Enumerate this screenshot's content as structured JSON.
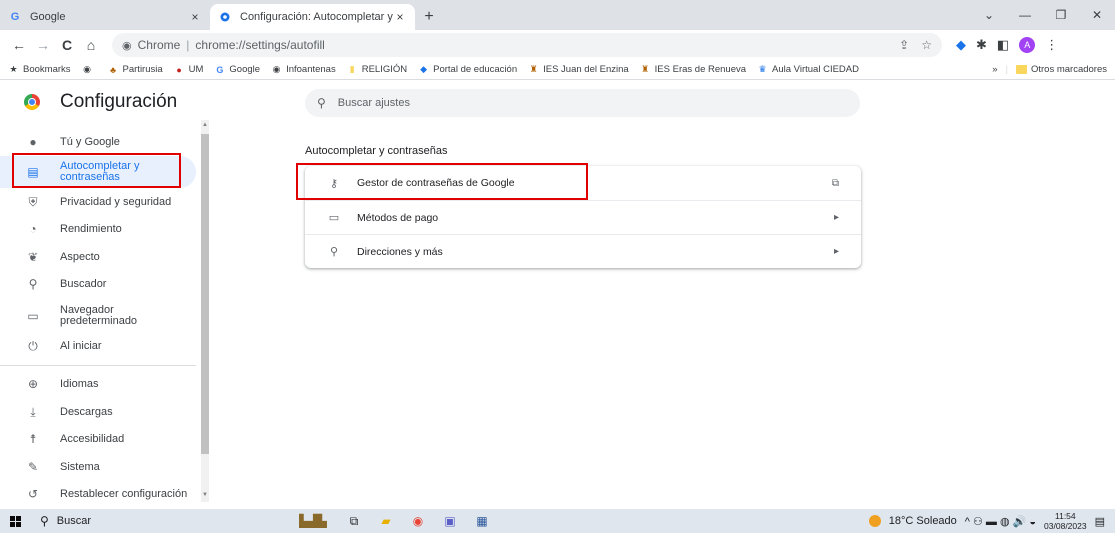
{
  "tabs": [
    {
      "title": "Google",
      "favicon": "G",
      "close": "×",
      "active": false
    },
    {
      "title": "Configuración: Autocompletar y ",
      "favicon": "gear-icon",
      "close": "×",
      "active": true
    }
  ],
  "new_tab": "+",
  "window_controls": {
    "chevron": "⌄",
    "minimize": "—",
    "restore": "❐",
    "close": "✕"
  },
  "toolbar": {
    "back": "←",
    "forward": "→",
    "reload": "C",
    "home": "⌂",
    "site_label": "Chrome",
    "separator": "|",
    "url": "chrome://settings/autofill",
    "share": "⇪",
    "star": "☆",
    "avatar_letter": "A",
    "menu": "⋮"
  },
  "bookmarks": {
    "items": [
      {
        "label": "Bookmarks",
        "icon": "★"
      },
      {
        "label": "",
        "icon": "◉"
      },
      {
        "label": "Partirusia",
        "icon": "♣"
      },
      {
        "label": "UM",
        "icon": "●"
      },
      {
        "label": "Google",
        "icon": "G"
      },
      {
        "label": "Infoantenas",
        "icon": "◉"
      },
      {
        "label": "RELIGIÓN",
        "icon": "▮"
      },
      {
        "label": "Portal de educación",
        "icon": "◆"
      },
      {
        "label": "IES Juan del Enzina",
        "icon": "♜"
      },
      {
        "label": "IES Eras de Renueva",
        "icon": "♜"
      },
      {
        "label": "Aula Virtual CIEDAD",
        "icon": "♛"
      }
    ],
    "more": "»",
    "other_folder": "Otros marcadores"
  },
  "settings": {
    "title": "Configuración",
    "search_placeholder": "Buscar ajustes"
  },
  "sidebar": {
    "items": [
      {
        "label": "Tú y Google",
        "icon": "👤"
      },
      {
        "label": "Autocompletar y contraseñas",
        "icon": "▤",
        "selected": true
      },
      {
        "label": "Privacidad y seguridad",
        "icon": "⛨"
      },
      {
        "label": "Rendimiento",
        "icon": "◔"
      },
      {
        "label": "Aspecto",
        "icon": "🎨"
      },
      {
        "label": "Buscador",
        "icon": "⌕"
      },
      {
        "label": "Navegador predeterminado",
        "icon": "▭"
      },
      {
        "label": "Al iniciar",
        "icon": "⏻"
      },
      {
        "label": "Idiomas",
        "icon": "⊕"
      },
      {
        "label": "Descargas",
        "icon": "⤓"
      },
      {
        "label": "Accesibilidad",
        "icon": "☨"
      },
      {
        "label": "Sistema",
        "icon": "🔧"
      },
      {
        "label": "Restablecer configuración",
        "icon": "↺"
      }
    ]
  },
  "main": {
    "section_title": "Autocompletar y contraseñas",
    "rows": [
      {
        "label": "Gestor de contraseñas de Google",
        "icon": "⚷",
        "end": "⧉"
      },
      {
        "label": "Métodos de pago",
        "icon": "▭",
        "end": "▸"
      },
      {
        "label": "Direcciones y más",
        "icon": "⚲",
        "end": "▸"
      }
    ]
  },
  "taskbar": {
    "search_label": "Buscar",
    "weather": "18°C  Soleado",
    "tray_icons": "^  ⚇  ▬  ◍  🔊  ◒",
    "time": "11:54",
    "date": "03/08/2023",
    "notification": "▤"
  }
}
